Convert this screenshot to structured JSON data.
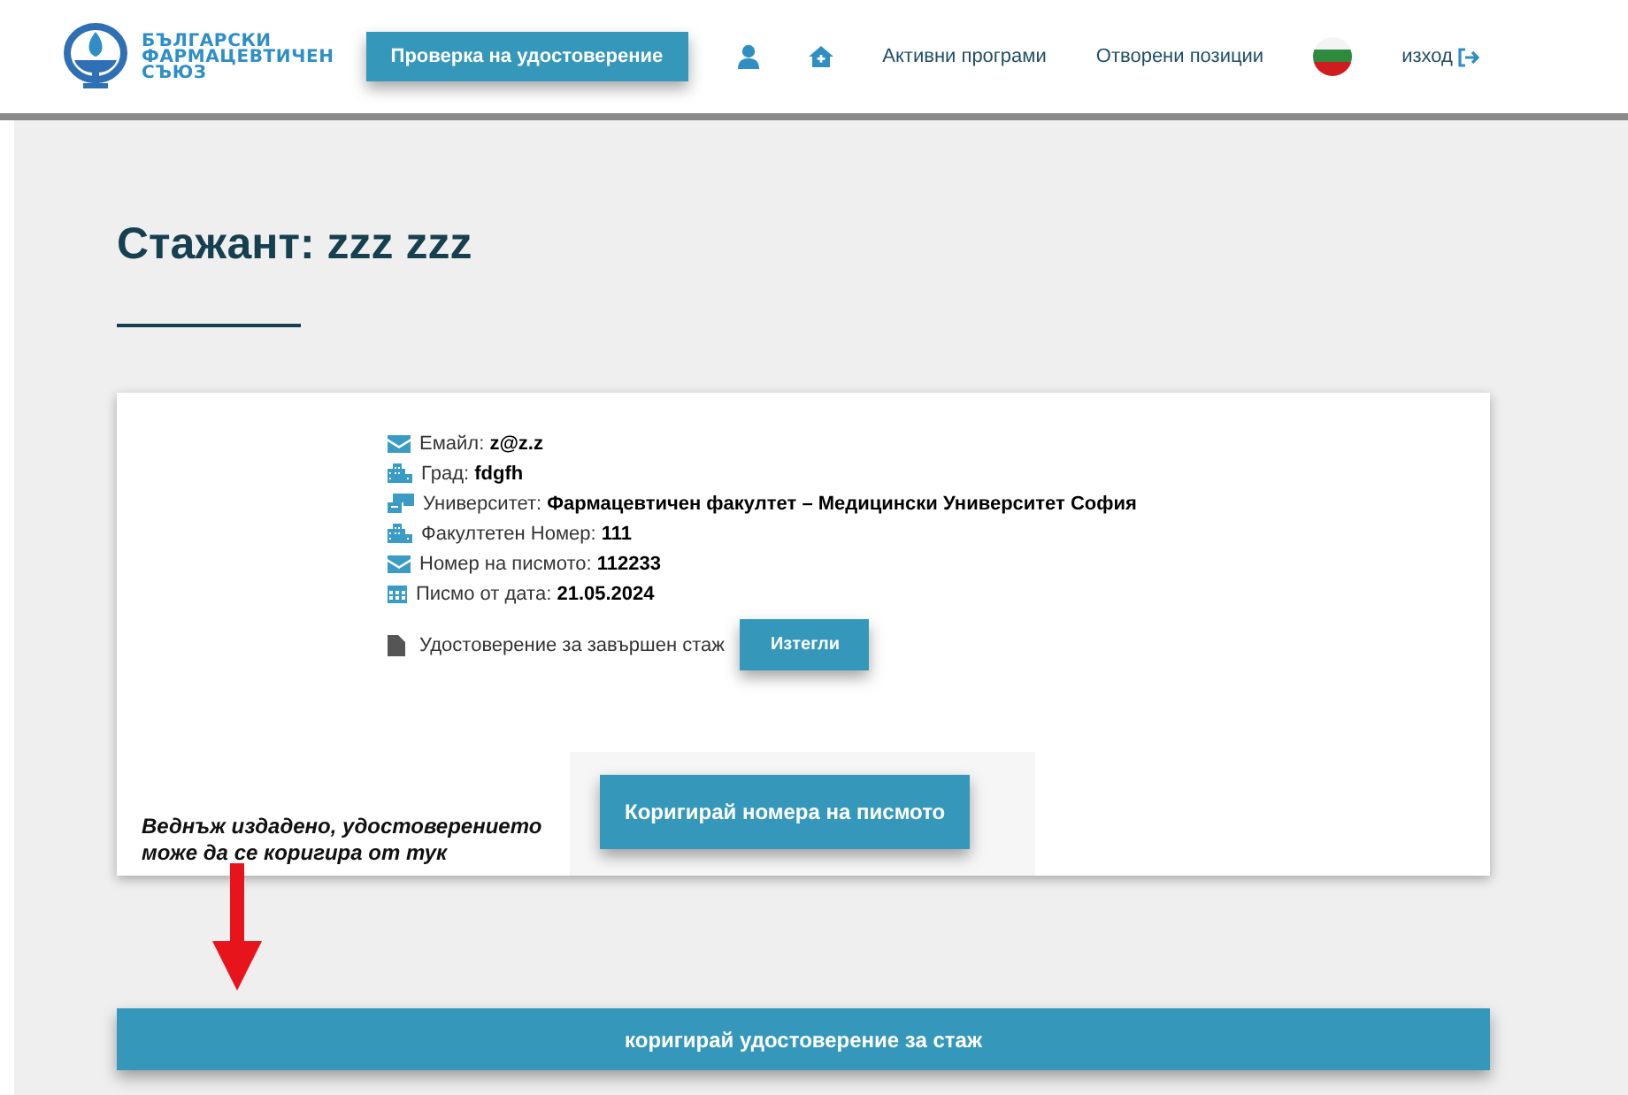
{
  "header": {
    "logo_lines": [
      "БЪЛГАРСКИ",
      "ФАРМАЦЕВТИЧЕН",
      "СЪЮЗ"
    ],
    "nav": [
      {
        "kind": "button",
        "label": "Проверка на удостоверение"
      },
      {
        "kind": "user"
      },
      {
        "kind": "home"
      },
      {
        "kind": "link",
        "label": "Активни програми"
      },
      {
        "kind": "link",
        "label": "Отворени позиции"
      },
      {
        "kind": "flag"
      },
      {
        "kind": "logout",
        "label": "изход"
      }
    ]
  },
  "page_title": "Стажант: zzz zzz",
  "details": [
    {
      "kind": "mail",
      "label": "Емайл:",
      "value": "z@z.z"
    },
    {
      "kind": "building",
      "label": "Град:",
      "value": "fdgfh"
    },
    {
      "kind": "school",
      "label": "Университет:",
      "value": "Фармацевтичен факултет – Медицински Университет София"
    },
    {
      "kind": "building",
      "label": "Факултетен Номер:",
      "value": "111"
    },
    {
      "kind": "mail",
      "label": "Номер на писмото:",
      "value": "112233"
    },
    {
      "kind": "calendar",
      "label": "Писмо от дата:",
      "value": "21.05.2024"
    }
  ],
  "certificate": {
    "label": "Удостоверение за завършен стаж",
    "button": "Изтегли"
  },
  "annotation": {
    "note": "Веднъж издадено, удостоверението може да се коригира от тук"
  },
  "correct_number_button": "Коригирай номера на писмото",
  "correct_certificate_button": "коригирай удостоверение за стаж"
}
